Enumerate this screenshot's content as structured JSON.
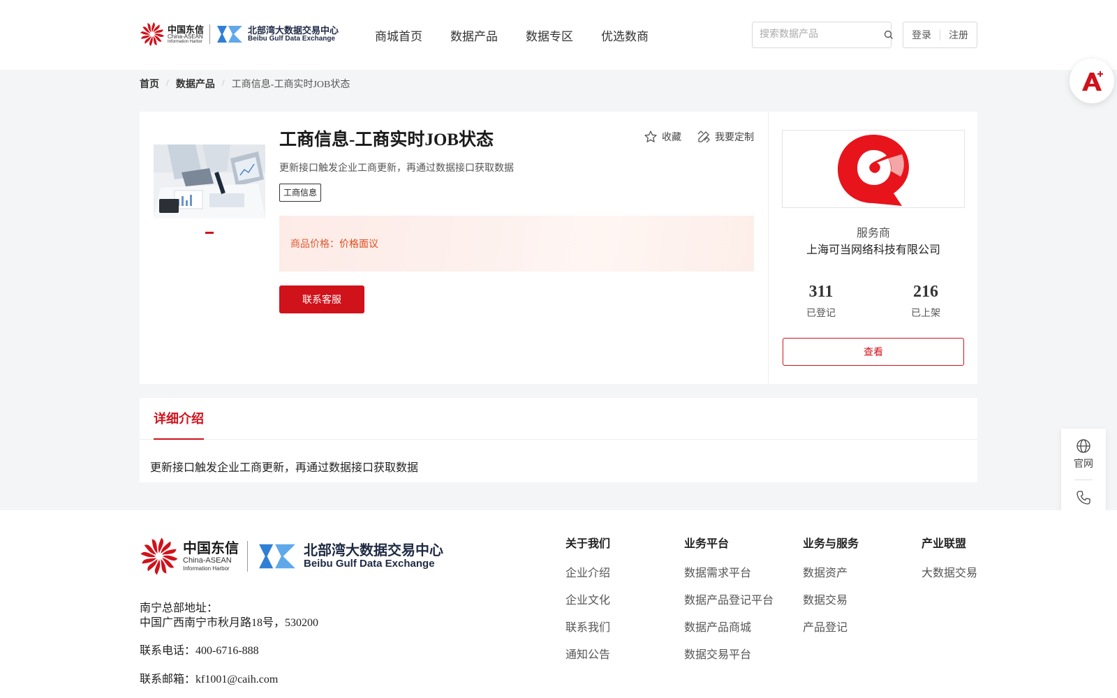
{
  "header": {
    "logo_cn": "中国东信",
    "logo_cn_en": "China-ASEAN",
    "logo_cn_en2": "Information Harbor",
    "logo_bx": "北部湾大数据交易中心",
    "logo_bx_en": "Beibu Gulf Data Exchange",
    "nav": [
      "商城首页",
      "数据产品",
      "数据专区",
      "优选数商"
    ],
    "search_placeholder": "搜索数据产品",
    "login": "登录",
    "register": "注册"
  },
  "breadcrumb": {
    "home": "首页",
    "category": "数据产品",
    "current": "工商信息-工商实时JOB状态"
  },
  "product": {
    "title": "工商信息-工商实时JOB状态",
    "favorite": "收藏",
    "customize": "我要定制",
    "description": "更新接口触发企业工商更新，再通过数据接口获取数据",
    "tag": "工商信息",
    "price_label": "商品价格：",
    "price_value": "价格面议",
    "contact_button": "联系客服"
  },
  "provider": {
    "label": "服务商",
    "name": "上海可当网络科技有限公司",
    "registered_count": "311",
    "registered_label": "已登记",
    "listed_count": "216",
    "listed_label": "已上架",
    "view_button": "查看"
  },
  "detail": {
    "tab": "详细介绍",
    "content": "更新接口触发企业工商更新，再通过数据接口获取数据"
  },
  "side_tools": {
    "website": "官网",
    "contact": "联系"
  },
  "footer": {
    "address_label": "南宁总部地址：",
    "address": "中国广西南宁市秋月路18号，530200",
    "phone": "联系电话：400-6716-888",
    "email": "联系邮箱：kf1001@caih.com",
    "columns": [
      {
        "title": "关于我们",
        "links": [
          "企业介绍",
          "企业文化",
          "联系我们",
          "通知公告"
        ]
      },
      {
        "title": "业务平台",
        "links": [
          "数据需求平台",
          "数据产品登记平台",
          "数据产品商城",
          "数据交易平台"
        ]
      },
      {
        "title": "业务与服务",
        "links": [
          "数据资产",
          "数据交易",
          "产品登记"
        ]
      },
      {
        "title": "产业联盟",
        "links": [
          "大数据交易"
        ]
      }
    ]
  },
  "colors": {
    "brand_red": "#d0121b",
    "price_orange": "#e05a2f",
    "logo_blue": "#2f7fd6"
  }
}
